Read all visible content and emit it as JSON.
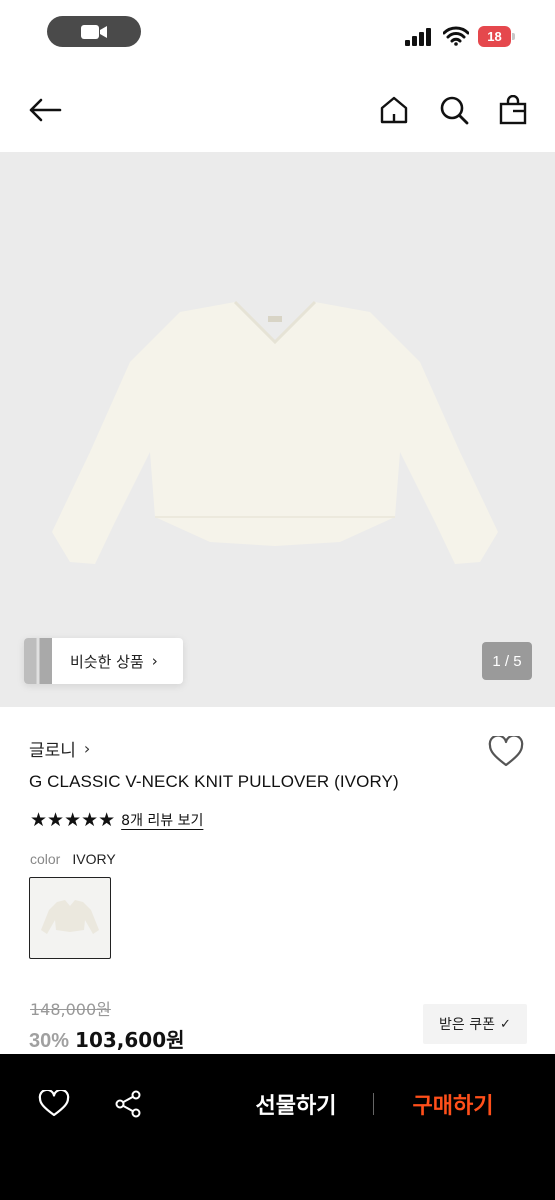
{
  "status_bar": {
    "battery_level": "18",
    "recording_icon": "video-camera-icon",
    "colors": {
      "battery": "#e5484d",
      "pill": "#4a4a4a"
    }
  },
  "header": {
    "back_icon": "arrow-left-icon",
    "home_icon": "home-icon",
    "search_icon": "search-icon",
    "bag_icon": "shopping-bag-icon"
  },
  "gallery": {
    "similar_label": "비슷한 상품",
    "page_indicator": "1 / 5",
    "image_alt_icon": "sweater-image"
  },
  "product": {
    "brand": "글로니",
    "title": "G CLASSIC V-NECK KNIT PULLOVER (IVORY)",
    "rating_stars": 5,
    "stars_text": "★★★★★",
    "review_link": "8개 리뷰 보기",
    "color_label": "color",
    "color_value": "IVORY"
  },
  "pricing": {
    "original_price": "148,000원",
    "discount": "30%",
    "sale_price": "103,600원",
    "coupon_label": "받은 쿠폰",
    "coupon_check": "✓"
  },
  "bottom_bar": {
    "wishlist_icon": "heart-icon",
    "share_icon": "share-icon",
    "gift_label": "선물하기",
    "buy_label": "구매하기",
    "colors": {
      "background": "#000000",
      "buy": "#ff4f1a"
    }
  }
}
